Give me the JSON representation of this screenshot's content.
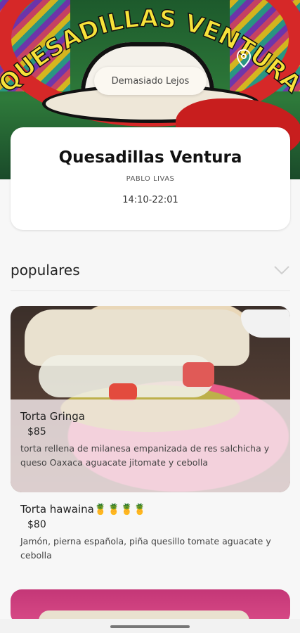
{
  "banner": {
    "brand_text": "QUESADILLAS VENTURA",
    "distance_label": "Demasiado Lejos",
    "icons": {
      "location": "location-pin-icon"
    }
  },
  "restaurant": {
    "name": "Quesadillas Ventura",
    "owner": "PABLO LIVAS",
    "hours": "14:10-22:01"
  },
  "section": {
    "title": "populares",
    "collapse_icon": "chevron-down-icon"
  },
  "dishes": [
    {
      "name": "Torta Gringa",
      "price": "$85",
      "description": "torta rellena de milanesa empanizada de res salchicha y queso Oaxaca aguacate jitomate y cebolla"
    },
    {
      "name": "Torta hawaina🍍🍍🍍🍍",
      "price": "$80",
      "description": "Jamón, pierna española, piña quesillo tomate aguacate y cebolla"
    }
  ],
  "colors": {
    "arc_red": "#d62828",
    "banner_green": "#2e7a3a",
    "card_bg": "#ffffff"
  }
}
